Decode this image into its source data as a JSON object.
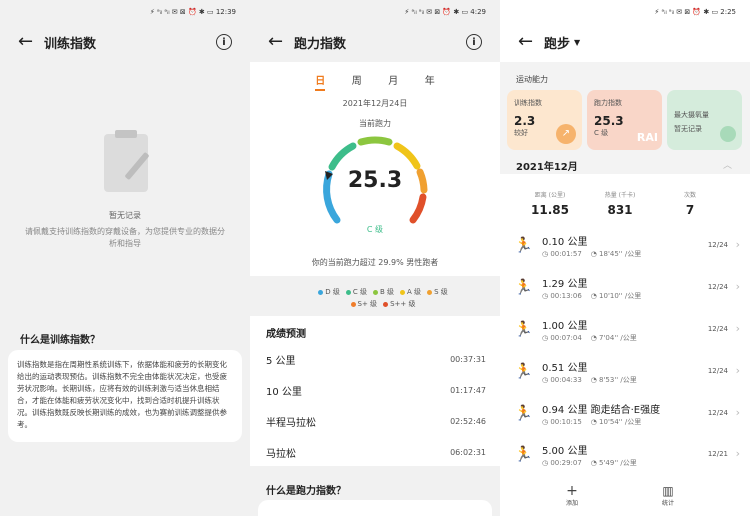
{
  "panel1": {
    "status": "⚡ ᵃᵢₗ ᵃᵢₗ ✉ ⊠ ⏰ ✱ ▭ 12:39",
    "title": "训练指数",
    "no_record": "暂无记录",
    "hint": "请佩戴支持训练指数的穿戴设备，为您提供专业的数据分析和指导",
    "what_title": "什么是训练指数？",
    "description": "训练指数是指在周期性系统训练下，依据体能和疲劳的长期变化给出的运动表现预估。训练指数不完全由体能状况决定，也受疲劳状况影响。长期训练，应将有效的训练刺激与适当休息相结合，才能在体能和疲劳状况变化中，找到合适时机提升训练状况。训练指数既反映长期训练的成效，也为赛前训练调整提供参考。"
  },
  "panel2": {
    "status": "⚡ ᵃᵢₗ ᵃᵢₗ ✉ ⊠ ⏰ ✱ ▭ 4:29",
    "title": "跑力指数",
    "tabs": [
      "日",
      "周",
      "月",
      "年"
    ],
    "date": "2021年12月24日",
    "gauge_label": "当前跑力",
    "value": "25.3",
    "grade": "C 级",
    "compare": "你的当前跑力超过 29.9% 男性跑者",
    "legend": [
      {
        "label": "D 级",
        "color": "#3aa6dc"
      },
      {
        "label": "C 级",
        "color": "#3dbd8a"
      },
      {
        "label": "B 级",
        "color": "#8cc63f"
      },
      {
        "label": "A 级",
        "color": "#f0c419"
      },
      {
        "label": "S 级",
        "color": "#f0a030"
      },
      {
        "label": "S+ 级",
        "color": "#ef7d2b"
      },
      {
        "label": "S++ 级",
        "color": "#e0502a"
      }
    ],
    "prediction_title": "成绩预测",
    "predictions": [
      {
        "name": "5 公里",
        "time": "00:37:31"
      },
      {
        "name": "10 公里",
        "time": "01:17:47"
      },
      {
        "name": "半程马拉松",
        "time": "02:52:46"
      },
      {
        "name": "马拉松",
        "time": "06:02:31"
      }
    ],
    "what_title": "什么是跑力指数？"
  },
  "panel3": {
    "status": "⚡ ᵃᵢₗ ᵃᵢₗ ✉ ⊠ ⏰ ✱ ▭ 2:25",
    "title": "跑步",
    "ability_label": "运动能力",
    "tiles": [
      {
        "label": "训练指数",
        "value": "2.3",
        "sub": "较好",
        "color": "#fde7cf",
        "badge": ""
      },
      {
        "label": "跑力指数",
        "value": "25.3",
        "sub": "C 级",
        "color": "#f9d6c8",
        "badge": "RAI"
      },
      {
        "label": "最大摄氧量",
        "value": "",
        "sub": "暂无记录",
        "color": "#d5ecdc",
        "badge": ""
      }
    ],
    "month": "2021年12月",
    "stats": [
      {
        "label": "距离 (公里)",
        "value": "11.85"
      },
      {
        "label": "热量 (千卡)",
        "value": "831"
      },
      {
        "label": "次数",
        "value": "7"
      }
    ],
    "runs": [
      {
        "dist": "0.10 公里",
        "dur": "00:01:57",
        "pace": "18'45'' /公里",
        "date": "12/24"
      },
      {
        "dist": "1.29 公里",
        "dur": "00:13:06",
        "pace": "10'10'' /公里",
        "date": "12/24"
      },
      {
        "dist": "1.00 公里",
        "dur": "00:07:04",
        "pace": "7'04'' /公里",
        "date": "12/24"
      },
      {
        "dist": "0.51 公里",
        "dur": "00:04:33",
        "pace": "8'53'' /公里",
        "date": "12/24"
      },
      {
        "dist": "0.94 公里 跑走结合·E强度",
        "dur": "00:10:15",
        "pace": "10'54'' /公里",
        "date": "12/24"
      },
      {
        "dist": "5.00 公里",
        "dur": "00:29:07",
        "pace": "5'49'' /公里",
        "date": "12/21"
      }
    ],
    "nav_add": "添加",
    "nav_other": "统计"
  }
}
